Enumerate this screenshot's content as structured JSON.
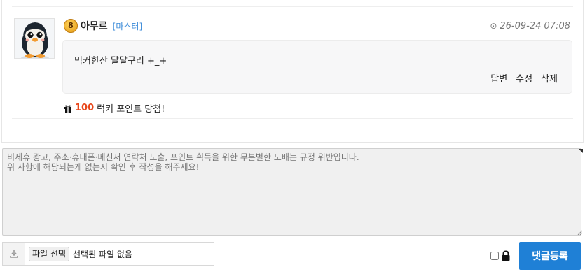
{
  "comment": {
    "level": "8",
    "nickname": "아무르",
    "grade": "[마스터]",
    "clock_glyph": "⊙",
    "date": "26-09-24 07:08",
    "body": "믹커한잔 달달구리 +_+",
    "actions": {
      "reply": "답변",
      "edit": "수정",
      "delete": "삭제"
    },
    "lucky": {
      "points": "100",
      "text": "럭키 포인트 당첨!"
    }
  },
  "form": {
    "placeholder": "비제휴 광고, 주소·휴대폰·메신저 연락처 노출, 포인트 획득을 위한 무분별한 도배는 규정 위반입니다.\n위 사항에 해당되는게 없는지 확인 후 작성을 해주세요!",
    "file_button": "파일 선택",
    "file_status": "선택된 파일 없음",
    "submit": "댓글등록"
  },
  "icons": {
    "avatar": "penguin-avatar",
    "level_badge": "level-badge-icon",
    "clock": "clock-icon",
    "gift": "gift-icon",
    "upload": "download-icon",
    "lock": "lock-icon"
  },
  "colors": {
    "accent": "#1f80d6",
    "grade": "#3a8ad8",
    "points": "#e8461a"
  }
}
